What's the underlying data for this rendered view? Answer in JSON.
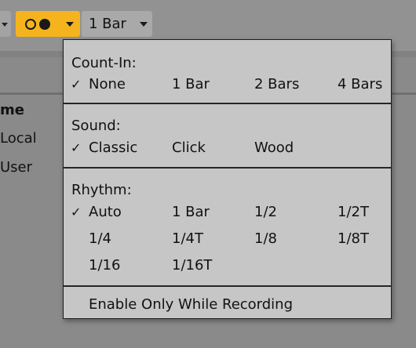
{
  "transport": {
    "metronome_icon": "metronome-icon",
    "count_in_value": "1 Bar",
    "accent_color": "#f5b31d"
  },
  "background": {
    "column_header": "me",
    "rows": [
      "Local",
      "User"
    ]
  },
  "menu": {
    "count_in": {
      "heading": "Count-In:",
      "options": [
        "None",
        "1 Bar",
        "2 Bars",
        "4 Bars"
      ],
      "selected": "None"
    },
    "sound": {
      "heading": "Sound:",
      "options": [
        "Classic",
        "Click",
        "Wood"
      ],
      "selected": "Classic"
    },
    "rhythm": {
      "heading": "Rhythm:",
      "options": [
        "Auto",
        "1 Bar",
        "1/2",
        "1/2T",
        "1/4",
        "1/4T",
        "1/8",
        "1/8T",
        "1/16",
        "1/16T"
      ],
      "selected": "Auto"
    },
    "enable_only_while_recording": "Enable Only While Recording",
    "checkmark": "✓"
  }
}
